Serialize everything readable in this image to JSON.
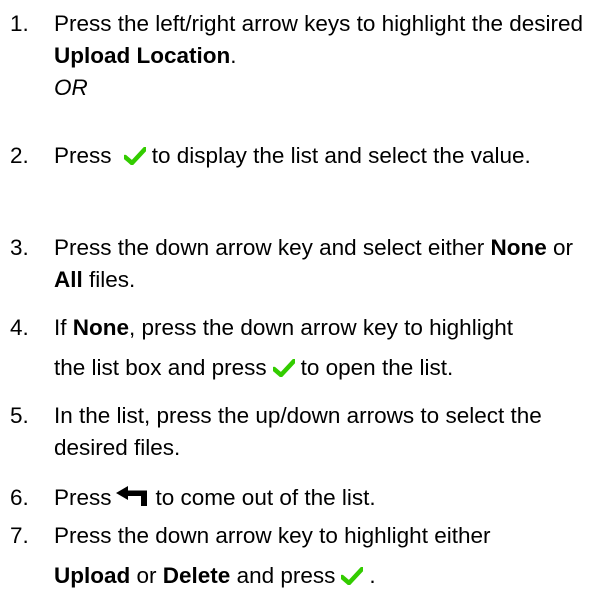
{
  "colors": {
    "check": "#33cc00",
    "text": "#000000"
  },
  "icons": {
    "check": "check-icon",
    "back": "return-arrow-icon"
  },
  "steps": [
    {
      "num": "1.",
      "a": "Press the left/right arrow keys to highlight the desired ",
      "b": "Upload Location",
      "c": "."
    },
    {
      "or": "OR"
    },
    {
      "num": "2.",
      "a": "Press",
      "b": "to display the list and select the value."
    },
    {
      "num": "3.",
      "a": "Press the down arrow key and select either ",
      "b": "None",
      "c": " or ",
      "d": "All",
      "e": " files."
    },
    {
      "num": "4.",
      "a": "If ",
      "b": "None",
      "c": ", press the down arrow key to highlight",
      "d": "the list box and press",
      "e": "to open the list."
    },
    {
      "num": "5.",
      "a": "In the list, press the up/down arrows to select the desired files."
    },
    {
      "num": "6.",
      "a": "Press",
      "b": "to come out of the list."
    },
    {
      "num": "7.",
      "a": "Press the down arrow key to highlight either",
      "b": "Upload",
      "c": " or ",
      "d": "Delete",
      "e": " and press",
      "f": "."
    }
  ]
}
